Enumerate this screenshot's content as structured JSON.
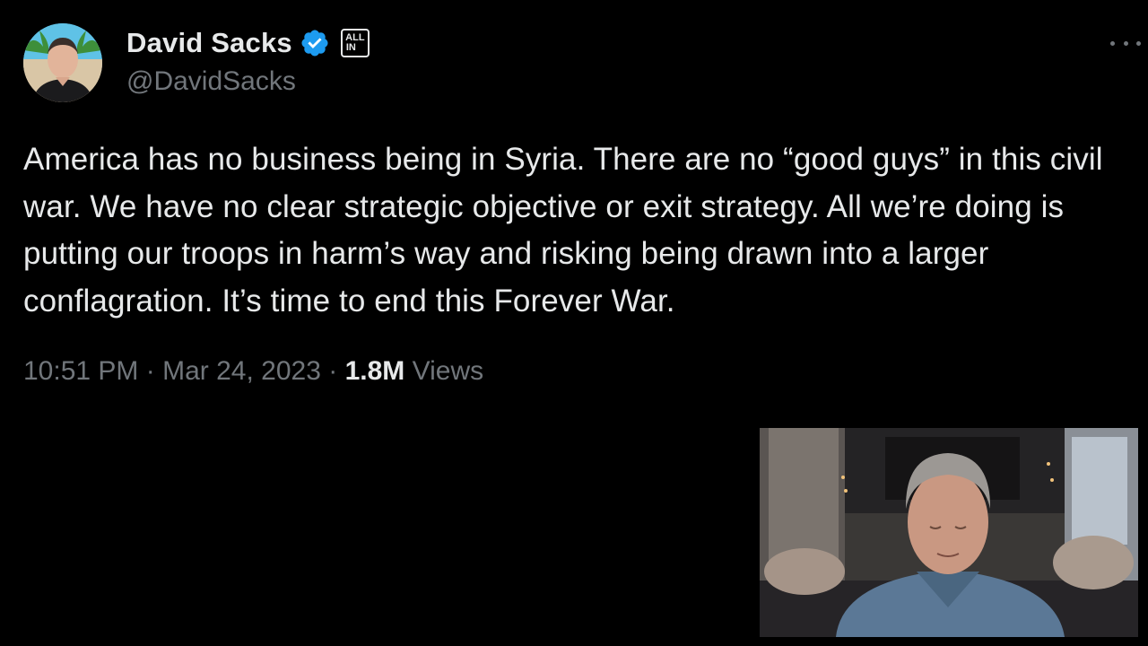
{
  "tweet": {
    "author": {
      "display_name": "David Sacks",
      "handle": "@DavidSacks",
      "verified_icon": "verified-badge-icon",
      "affiliate_badge": {
        "line1": "ALL",
        "line2": "IN"
      }
    },
    "more_menu_icon": "more-horizontal-icon",
    "text": "America has no business being in Syria. There are no “good guys” in this civil war. We have no clear strategic objective or exit strategy. All we’re doing is putting our troops in harm’s way and risking being drawn into a larger conflagration. It’s time to end this Forever War.",
    "time": "10:51 PM",
    "separator": "·",
    "date": "Mar 24, 2023",
    "views_count": "1.8M",
    "views_label": "Views"
  },
  "colors": {
    "background": "#000000",
    "primary_text": "#e7e9ea",
    "secondary_text": "#71767b",
    "verified_blue": "#1d9bf0"
  }
}
